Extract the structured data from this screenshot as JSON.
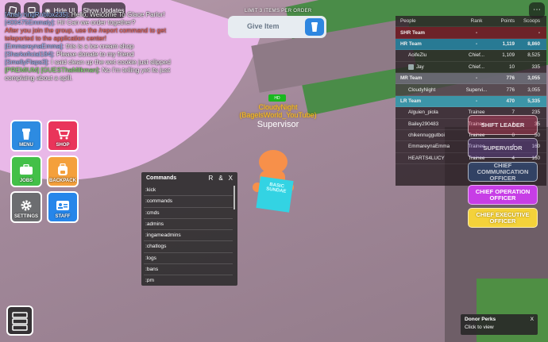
{
  "topbar": {
    "hide_ui": "Hide UI",
    "show_updates": "Show Updates"
  },
  "chat": {
    "lines": [
      {
        "speaker": "[AnalyzingRoblox235]:",
        "text": "Hello, Welcome To Glace Parlor!"
      },
      {
        "speaker": "[400475Emmaly]:",
        "text": "Hi! Can we order together?"
      },
      {
        "speaker": "",
        "text": "After you join the group, use the /report command to get teleported to the application center!"
      },
      {
        "speaker": "[EmmareynaEmma]:",
        "text": "this is a ice cream shop"
      },
      {
        "speaker": "[Sharkoficial184]:",
        "text": "Please donate to my friend"
      },
      {
        "speaker": "[SmellyFlaps3]:",
        "text": "I said clean up the wet cookie just slipped"
      },
      {
        "speaker": "[PREMIUM] [GUESThaMilkman]:",
        "text": "No I'm telling yet its just complaing about a spill."
      }
    ]
  },
  "donation": {
    "limit_text": "LIMIT 3 ITEMS PER ORDER",
    "give_item_label": "Give Item"
  },
  "character": {
    "badge": "HD",
    "name_line1": "CloudyNight",
    "name_line2": "(BagelsWorld_YouTube)",
    "role": "Supervisor",
    "sign_text": "BASIC SUNDAE"
  },
  "menu_buttons": {
    "menu": "MENU",
    "shop": "SHOP",
    "jobs": "JOBS",
    "backpack": "BACKPACK",
    "settings": "SETTINGS",
    "staff": "STAFF"
  },
  "commands": {
    "title": "Commands",
    "controls": [
      "R",
      "&",
      "X"
    ],
    "items": [
      ":kick",
      ":commands",
      ":cmds",
      ":admins",
      ":ingameadmins",
      ":chatlogs",
      ":logs",
      ":bans",
      ":pm"
    ]
  },
  "leaderboard": {
    "headers": {
      "name": "People",
      "rank": "Rank",
      "points": "Points",
      "scoops": "Scoops"
    },
    "rows": [
      {
        "kind": "team",
        "team": "shr",
        "name": "SHR Team",
        "rank": "-",
        "points": "",
        "scoops": "-"
      },
      {
        "kind": "team",
        "team": "hr",
        "name": "HR Team",
        "rank": "-",
        "points": "1,119",
        "scoops": "8,860"
      },
      {
        "kind": "player",
        "name": "AoifeZlu",
        "rank": "Chief...",
        "points": "1,109",
        "scoops": "8,525"
      },
      {
        "kind": "player",
        "name": "Jay",
        "rank": "Chief...",
        "points": "10",
        "scoops": "335",
        "avatar": true
      },
      {
        "kind": "team",
        "team": "mr",
        "name": "MR Team",
        "rank": "-",
        "points": "776",
        "scoops": "3,055"
      },
      {
        "kind": "player",
        "name": "CloudyNight",
        "rank": "Supervi...",
        "points": "776",
        "scoops": "3,055",
        "hl": true
      },
      {
        "kind": "team",
        "team": "lr",
        "name": "LR Team",
        "rank": "-",
        "points": "470",
        "scoops": "5,335"
      },
      {
        "kind": "player",
        "name": "Alguien_piola",
        "rank": "Trainee",
        "points": "7",
        "scoops": "235"
      },
      {
        "kind": "player",
        "name": "Bailey290483",
        "rank": "Trainee",
        "points": "1",
        "scoops": "35"
      },
      {
        "kind": "player",
        "name": "chikennuggutboi",
        "rank": "Trainee",
        "points": "0",
        "scoops": "50"
      },
      {
        "kind": "player",
        "name": "EmmareynaEmma",
        "rank": "Trainee",
        "points": "4",
        "scoops": "160"
      },
      {
        "kind": "player",
        "name": "HEARTS4LUCY",
        "rank": "Trainee",
        "points": "4",
        "scoops": "160"
      }
    ]
  },
  "jobs": {
    "shift_leader": "SHIFT LEADER",
    "supervisor": "SUPERVISOR",
    "chief_comm": "CHIEF COMMUNICATION OFFICER",
    "chief_op": "CHIEF OPERATION OFFICER",
    "chief_exec": "CHIEF EXECUTIVE OFFICER"
  },
  "donor_perks": {
    "title": "Donor Perks",
    "subtitle": "Click to view",
    "close": "X"
  }
}
